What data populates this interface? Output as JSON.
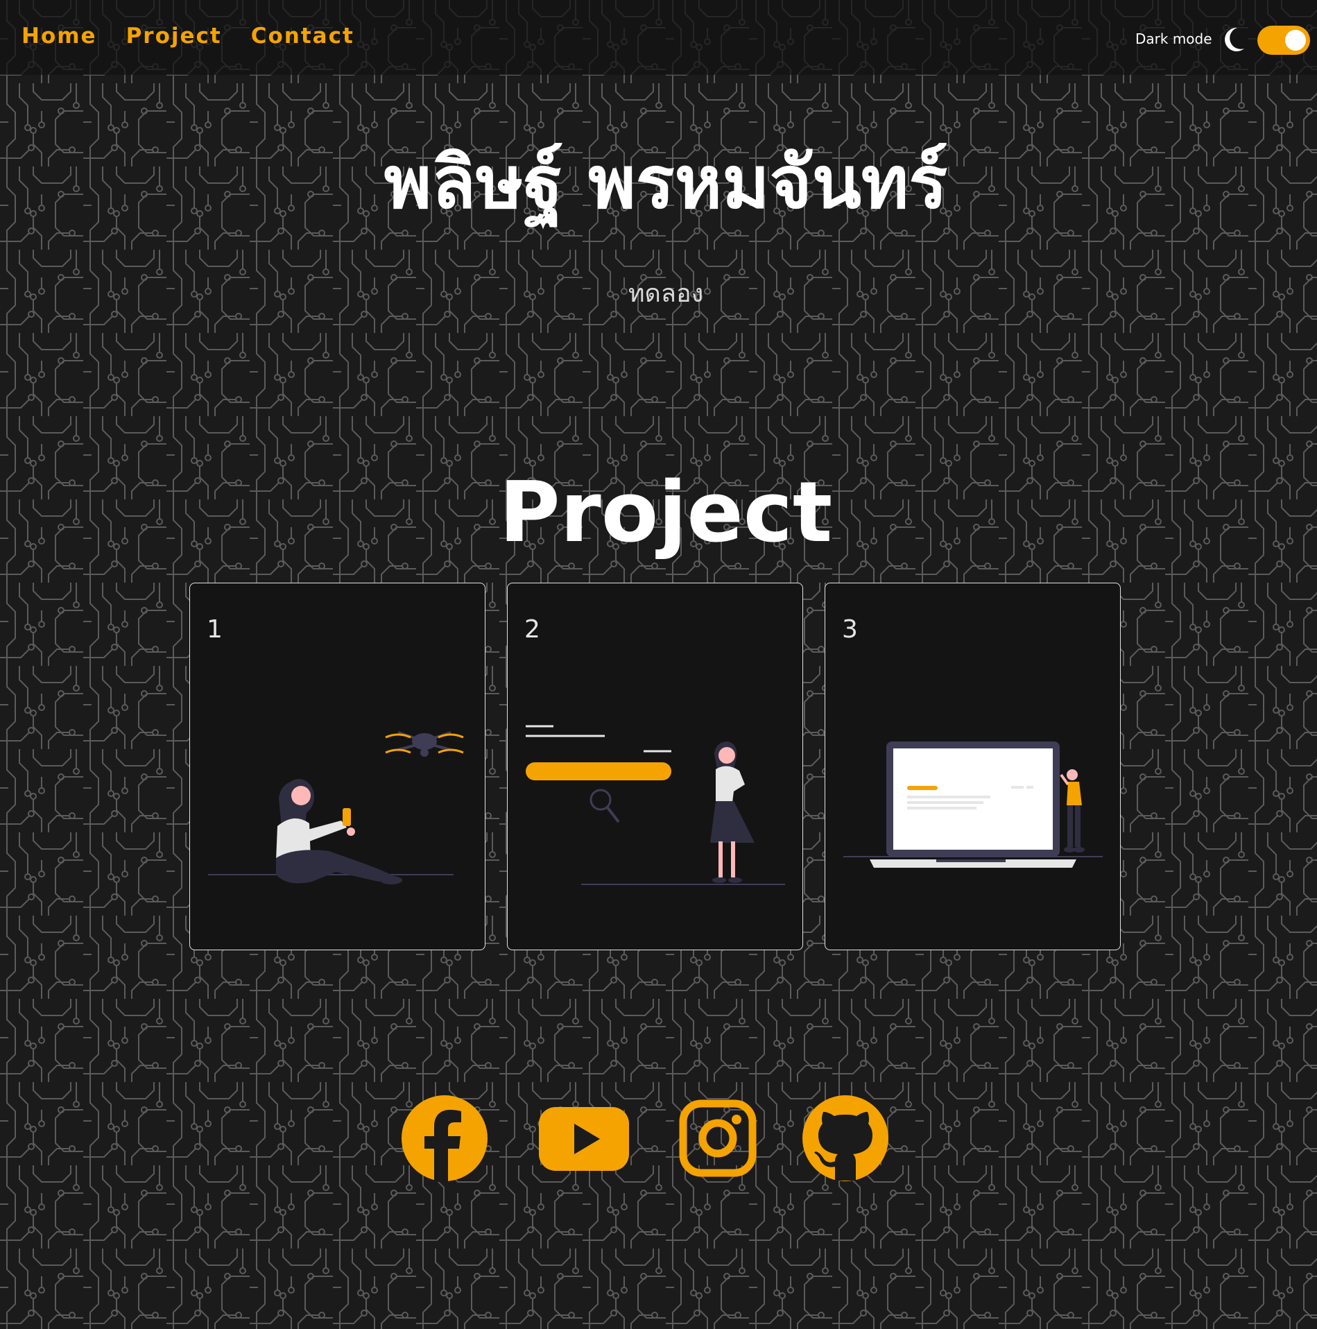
{
  "nav": {
    "links": [
      "Home",
      "Project",
      "Contact"
    ],
    "dark_mode_label": "Dark mode",
    "dark_mode_on": true,
    "moon_icon": "moon-icon"
  },
  "hero": {
    "name": "พลิษฐ์ พรหมจันทร์",
    "subtitle": "ทดลอง"
  },
  "projects": {
    "title": "Project",
    "cards": [
      {
        "number": "1",
        "illustration": "woman-flying-drone-illustration"
      },
      {
        "number": "2",
        "illustration": "woman-search-bar-illustration"
      },
      {
        "number": "3",
        "illustration": "woman-laptop-presentation-illustration"
      }
    ]
  },
  "socials": [
    "facebook-icon",
    "youtube-icon",
    "instagram-icon",
    "github-icon"
  ],
  "colors": {
    "accent": "#f5a300",
    "background": "#1b1b1b",
    "card_bg": "#141414",
    "circuit_lines": "#5a5a5a"
  }
}
